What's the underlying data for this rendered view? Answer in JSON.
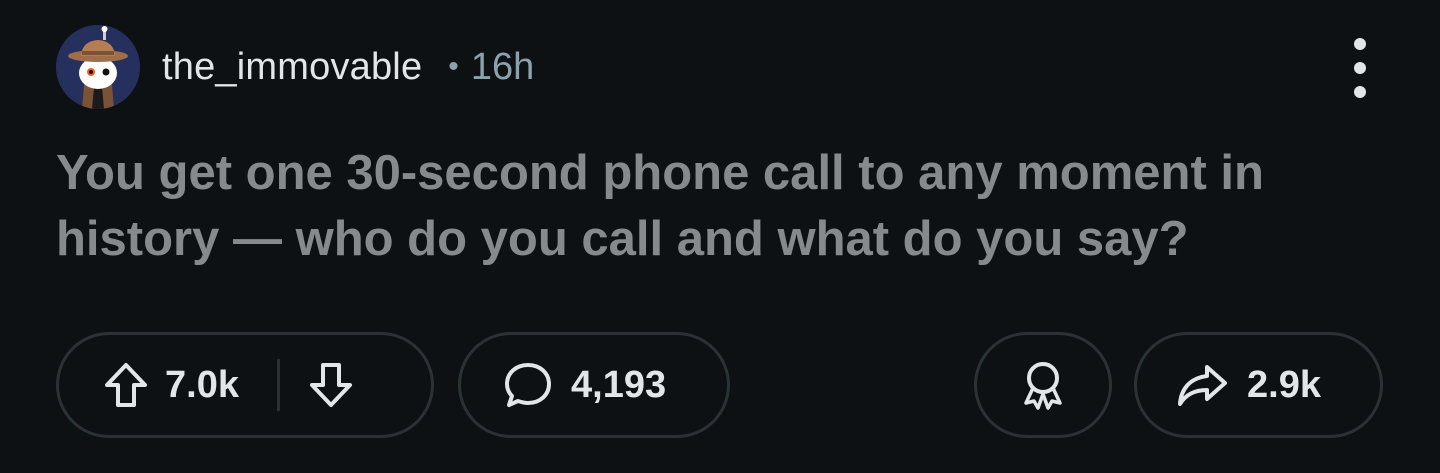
{
  "post": {
    "author": "the_immovable",
    "separator": "•",
    "time_ago": "16h",
    "title": "You get one 30-second phone call to any moment in history — who do you call and what do you say?"
  },
  "actions": {
    "upvotes": "7.0k",
    "comments": "4,193",
    "shares": "2.9k"
  },
  "icons": {
    "upvote": "arrow-up-icon",
    "downvote": "arrow-down-icon",
    "comment": "speech-bubble-icon",
    "award": "award-ribbon-icon",
    "share": "share-arrow-icon",
    "more": "kebab-menu-icon"
  },
  "colors": {
    "background": "#0e1113",
    "title": "#878a8c",
    "meta": "#8ba2ad",
    "pill_border": "#2b3236",
    "avatar_bg": "#25305e"
  }
}
